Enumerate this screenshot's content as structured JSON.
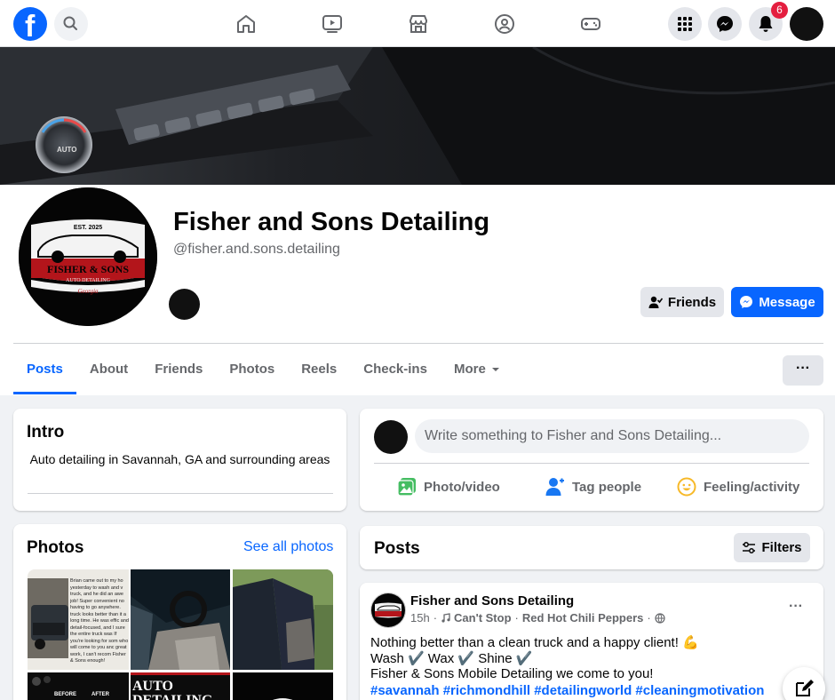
{
  "topnav": {
    "notification_count": "6",
    "icons": [
      "facebook-logo",
      "search-icon",
      "home-icon",
      "video-icon",
      "marketplace-icon",
      "groups-icon",
      "gaming-icon",
      "menu-grid-icon",
      "messenger-icon",
      "bell-icon"
    ]
  },
  "profile": {
    "name": "Fisher and Sons Detailing",
    "handle": "@fisher.and.sons.detailing",
    "logo": {
      "est": "EST. 2025",
      "brand": "FISHER & SONS",
      "sub": "AUTO DETAILING",
      "state": "Georgia"
    },
    "friends_label": "Friends",
    "message_label": "Message"
  },
  "tabs": [
    "Posts",
    "About",
    "Friends",
    "Photos",
    "Reels",
    "Check-ins",
    "More"
  ],
  "more_actions_label": "···",
  "intro": {
    "title": "Intro",
    "text": "Auto detailing in Savannah, GA and surrounding areas"
  },
  "photos": {
    "title": "Photos",
    "see_all": "See all photos",
    "thumb_texts": {
      "before": "BEFORE",
      "after": "AFTER",
      "auto": "AUTO",
      "detailing": "DETAILING"
    },
    "review_text": "Brian came out to my ho yesterday to wash and v truck, and he did an awe job! Super convenient no having to go anywhere. truck looks better than it a long time. He was effic and detail-focused, and I sure the entire truck was If you're looking for som who will come to you anc great work, I can't recom Fisher & Sons enough!"
  },
  "composer": {
    "placeholder": "Write something to Fisher and Sons Detailing...",
    "actions": [
      "Photo/video",
      "Tag people",
      "Feeling/activity"
    ]
  },
  "posts_section": {
    "title": "Posts",
    "filters_label": "Filters"
  },
  "post": {
    "author": "Fisher and Sons Detailing",
    "time": "15h",
    "song": "Can't Stop",
    "artist": "Red Hot Chili Peppers",
    "more_label": "···",
    "line1": "Nothing better than a clean truck and a happy client! 💪",
    "line2": "Wash ✔️ Wax ✔️ Shine ✔️",
    "line3": "Fisher & Sons Mobile Detailing we come to you!",
    "hashtags": "#savannah #richmondhill #detailingworld #cleaningmotivation"
  },
  "colors": {
    "accent": "#0866ff",
    "badge": "#e41e3f",
    "logo_red": "#b3151b"
  }
}
